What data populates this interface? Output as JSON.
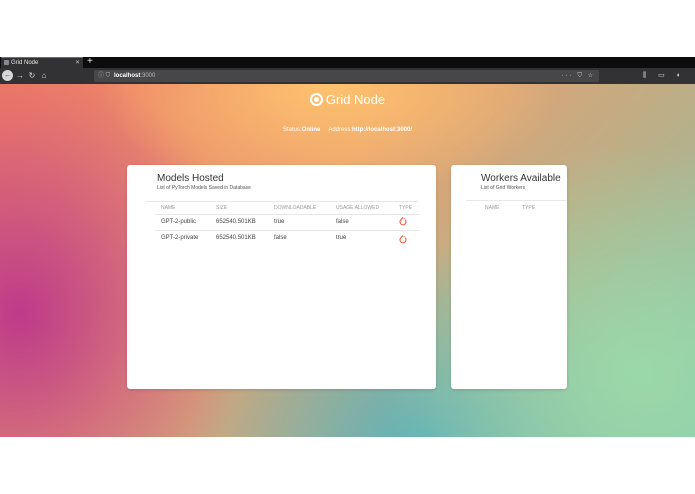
{
  "browser": {
    "tab_title": "Grid Node",
    "new_tab": "+",
    "url_host": "localhost",
    "url_port": ":3000",
    "url_actions": "··· ⛉ ☆",
    "toolbar_icons": "⫼ ▭ ◐ ≡"
  },
  "header": {
    "brand": "Grid Node",
    "status_label": "Status:",
    "status_value": "Online",
    "address_label": "Address:",
    "address_value": "http://localhost:3000/"
  },
  "models": {
    "title": "Models Hosted",
    "subtitle": "List of PyTorch Models Saved in Database",
    "columns": [
      "NAME",
      "SIZE",
      "DOWNLOADABLE",
      "USAGE ALLOWED",
      "TYPE"
    ],
    "rows": [
      {
        "name": "GPT-2-public",
        "size": "652540.501KB",
        "downloadable": "true",
        "usage_allowed": "false",
        "type": "pytorch-icon"
      },
      {
        "name": "GPT-2-private",
        "size": "652540.501KB",
        "downloadable": "false",
        "usage_allowed": "true",
        "type": "pytorch-icon"
      }
    ]
  },
  "workers": {
    "title": "Workers Available",
    "subtitle": "List of Grid Workers",
    "columns": [
      "NAME",
      "TYPE"
    ]
  },
  "colors": {
    "pytorch": "#ee4c2c",
    "tab_accent": "#0a84ff"
  }
}
